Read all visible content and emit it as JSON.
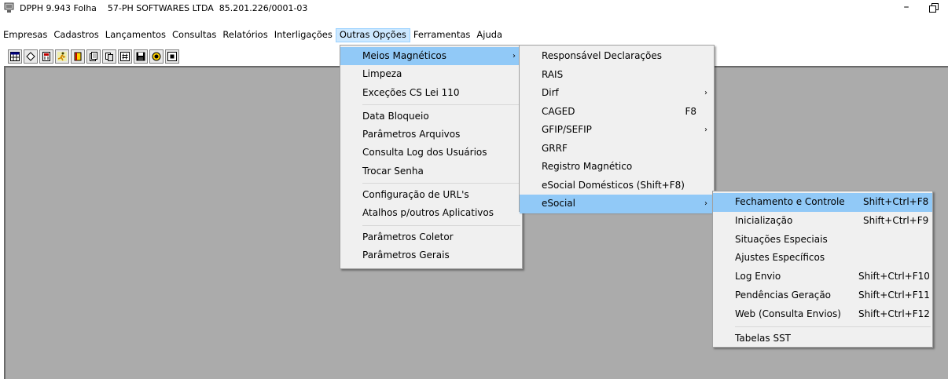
{
  "window": {
    "title": "DPPH 9.943 Folha    57-PH SOFTWARES LTDA  85.201.226/0001-03",
    "minimize_glyph": "–"
  },
  "menubar": {
    "items": [
      "Empresas",
      "Cadastros",
      "Lançamentos",
      "Consultas",
      "Relatórios",
      "Interligações",
      "Outras Opções",
      "Ferramentas",
      "Ajuda"
    ],
    "active": "Outras Opções"
  },
  "toolbar": {
    "buttons": [
      "table-icon",
      "diamond-icon",
      "calculator-icon",
      "runner-icon",
      "book-icon",
      "document-icon",
      "copy-icon",
      "hash-icon",
      "save-icon",
      "target-icon",
      "square-icon"
    ]
  },
  "outras_menu": {
    "items": [
      {
        "label": "Meios Magnéticos",
        "submenu": true,
        "highlighted": true
      },
      {
        "label": "Limpeza"
      },
      {
        "label": "Exceções CS Lei 110"
      },
      {
        "label": "Data Bloqueio"
      },
      {
        "label": "Parâmetros Arquivos"
      },
      {
        "label": "Consulta Log dos Usuários"
      },
      {
        "label": "Trocar Senha"
      },
      {
        "label": "Configuração de URL's"
      },
      {
        "label": "Atalhos p/outros Aplicativos"
      },
      {
        "label": "Parâmetros Coletor"
      },
      {
        "label": "Parâmetros Gerais"
      }
    ]
  },
  "meios_menu": {
    "items": [
      {
        "label": "Responsável Declarações"
      },
      {
        "label": "RAIS"
      },
      {
        "label": "Dirf",
        "submenu": true
      },
      {
        "label": "CAGED",
        "shortcut": "F8"
      },
      {
        "label": "GFIP/SEFIP",
        "submenu": true
      },
      {
        "label": "GRRF"
      },
      {
        "label": "Registro Magnético"
      },
      {
        "label": "eSocial Domésticos (Shift+F8)"
      },
      {
        "label": "eSocial",
        "submenu": true,
        "highlighted": true
      }
    ]
  },
  "esocial_menu": {
    "items": [
      {
        "label": "Fechamento e Controle",
        "shortcut": "Shift+Ctrl+F8",
        "highlighted": true
      },
      {
        "label": "Inicialização",
        "shortcut": "Shift+Ctrl+F9"
      },
      {
        "label": "Situações Especiais",
        "shortcut": ""
      },
      {
        "label": "Ajustes Específicos",
        "shortcut": ""
      },
      {
        "label": "Log Envio",
        "shortcut": "Shift+Ctrl+F10"
      },
      {
        "label": "Pendências Geração",
        "shortcut": "Shift+Ctrl+F11"
      },
      {
        "label": "Web (Consulta Envios)",
        "shortcut": "Shift+Ctrl+F12"
      },
      {
        "label": "Tabelas SST",
        "shortcut": ""
      }
    ]
  },
  "colors": {
    "highlight": "#91c9f7",
    "menu_bg": "#f0f0f0",
    "client_bg": "#ababab"
  }
}
